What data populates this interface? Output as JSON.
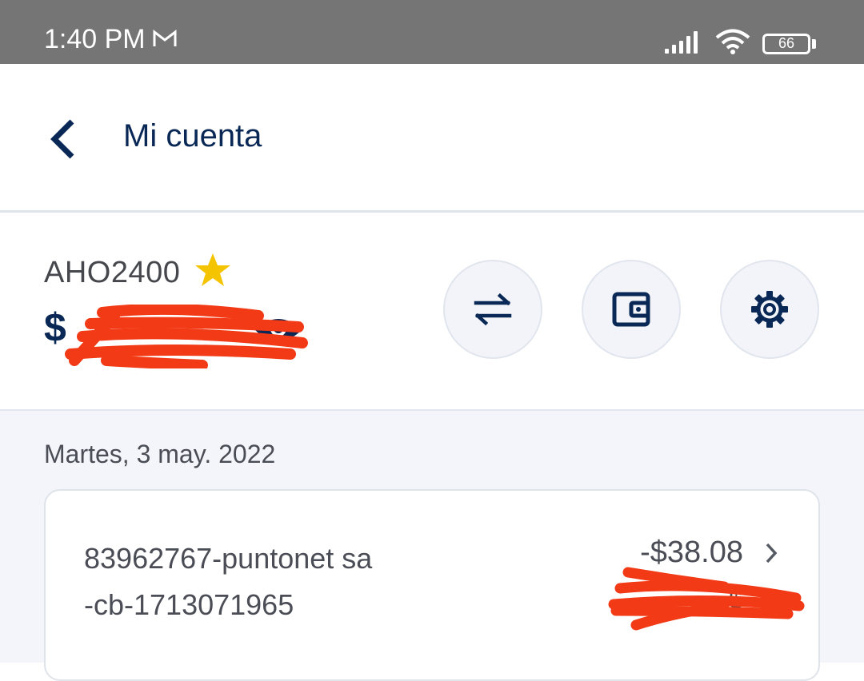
{
  "status_bar": {
    "time": "1:40 PM",
    "battery": "66",
    "icons": [
      "gmail-icon",
      "signal-icon",
      "wifi-icon",
      "battery-icon"
    ]
  },
  "header": {
    "title": "Mi cuenta",
    "back_icon": "chevron-left-icon"
  },
  "account": {
    "name": "AHO2400",
    "favorite_icon": "star-icon",
    "balance_prefix": "$",
    "actions": [
      {
        "name": "transfer",
        "icon": "transfer-arrows-icon"
      },
      {
        "name": "wallet",
        "icon": "wallet-icon"
      },
      {
        "name": "settings",
        "icon": "gear-icon"
      }
    ]
  },
  "transactions": {
    "date": "Martes, 3 may. 2022",
    "items": [
      {
        "desc_line1": "83962767-puntonet sa",
        "desc_line2": "-cb-1713071965",
        "amount": "-$38.08",
        "sub_amount": "$"
      }
    ]
  },
  "colors": {
    "brand_navy": "#0a2856",
    "status_bar": "#757575",
    "star": "#f5c400",
    "redaction": "#f23a16",
    "background": "#f3f5fa"
  }
}
